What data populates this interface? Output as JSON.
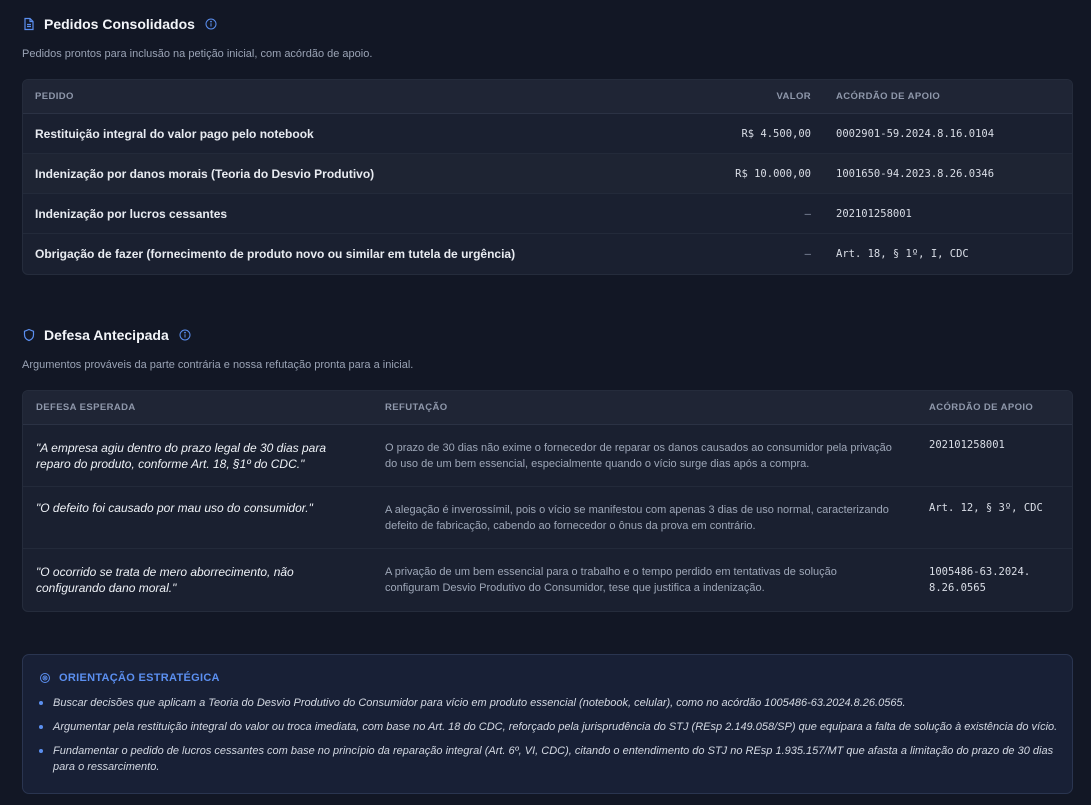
{
  "colors": {
    "background": "#121725",
    "accent": "#5b8ff0",
    "card": "#1a2030"
  },
  "pedidos": {
    "title": "Pedidos Consolidados",
    "title_icon": "document-icon",
    "subtitle": "Pedidos prontos para inclusão na petição inicial, com acórdão de apoio.",
    "headers": {
      "pedido": "PEDIDO",
      "valor": "VALOR",
      "acordao": "ACÓRDÃO DE APOIO"
    },
    "rows": [
      {
        "pedido": "Restituição integral do valor pago pelo notebook",
        "valor": "R$ 4.500,00",
        "acordao": "0002901-59.2024.8.16.0104"
      },
      {
        "pedido": "Indenização por danos morais (Teoria do Desvio Produtivo)",
        "valor": "R$ 10.000,00",
        "acordao": "1001650-94.2023.8.26.0346"
      },
      {
        "pedido": "Indenização por lucros cessantes",
        "valor": "—",
        "acordao": "202101258001"
      },
      {
        "pedido": "Obrigação de fazer (fornecimento de produto novo ou similar em tutela de urgência)",
        "valor": "—",
        "acordao": "Art. 18, § 1º, I, CDC"
      }
    ]
  },
  "defesa": {
    "title": "Defesa Antecipada",
    "title_icon": "shield-icon",
    "subtitle": "Argumentos prováveis da parte contrária e nossa refutação pronta para a inicial.",
    "headers": {
      "defesa": "DEFESA ESPERADA",
      "refutacao": "REFUTAÇÃO",
      "acordao": "ACÓRDÃO DE APOIO"
    },
    "rows": [
      {
        "defesa": "\"A empresa agiu dentro do prazo legal de 30 dias para reparo do produto, conforme Art. 18, §1º do CDC.\"",
        "refutacao": "O prazo de 30 dias não exime o fornecedor de reparar os danos causados ao consumidor pela privação do uso de um bem essencial, especialmente quando o vício surge dias após a compra.",
        "acordao": "202101258001"
      },
      {
        "defesa": "\"O defeito foi causado por mau uso do consumidor.\"",
        "refutacao": "A alegação é inverossímil, pois o vício se manifestou com apenas 3 dias de uso normal, caracterizando defeito de fabricação, cabendo ao fornecedor o ônus da prova em contrário.",
        "acordao": "Art. 12, § 3º, CDC"
      },
      {
        "defesa": "\"O ocorrido se trata de mero aborrecimento, não configurando dano moral.\"",
        "refutacao": "A privação de um bem essencial para o trabalho e o tempo perdido em tentativas de solução configuram Desvio Produtivo do Consumidor, tese que justifica a indenização.",
        "acordao": "1005486-63.2024.8.26.0565"
      }
    ]
  },
  "orientacao": {
    "title": "ORIENTAÇÃO ESTRATÉGICA",
    "title_icon": "target-icon",
    "items": [
      "Buscar decisões que aplicam a Teoria do Desvio Produtivo do Consumidor para vício em produto essencial (notebook, celular), como no acórdão 1005486-63.2024.8.26.0565.",
      "Argumentar pela restituição integral do valor ou troca imediata, com base no Art. 18 do CDC, reforçado pela jurisprudência do STJ (REsp 2.149.058/SP) que equipara a falta de solução à existência do vício.",
      "Fundamentar o pedido de lucros cessantes com base no princípio da reparação integral (Art. 6º, VI, CDC), citando o entendimento do STJ no REsp 1.935.157/MT que afasta a limitação do prazo de 30 dias para o ressarcimento."
    ]
  }
}
